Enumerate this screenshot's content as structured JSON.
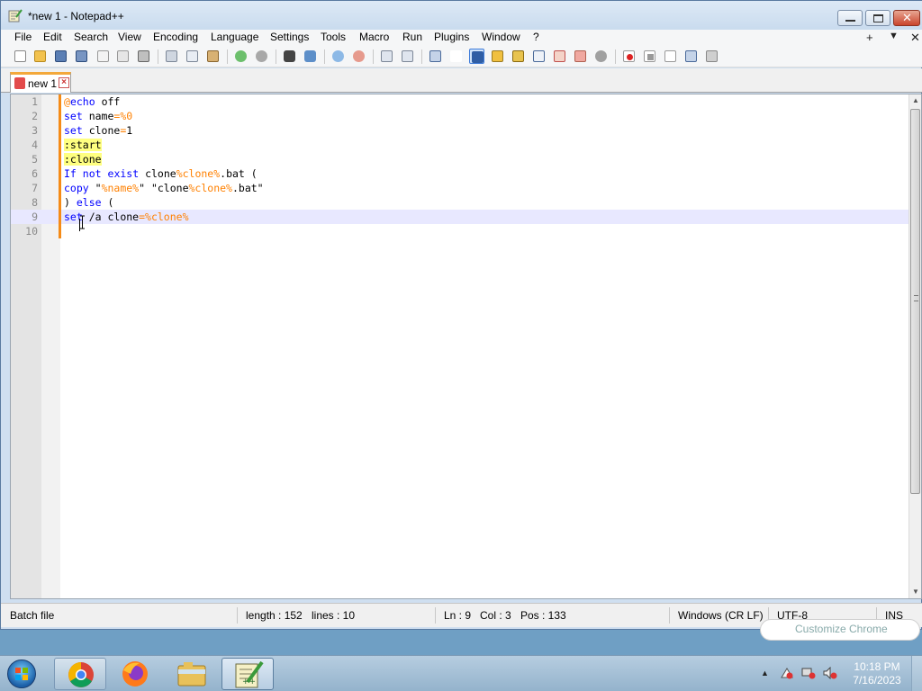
{
  "window": {
    "title": "*new 1 - Notepad++",
    "minimize_glyph": "",
    "close_glyph": "✕"
  },
  "menu": {
    "items": [
      "File",
      "Edit",
      "Search",
      "View",
      "Encoding",
      "Language",
      "Settings",
      "Tools",
      "Macro",
      "Run",
      "Plugins",
      "Window",
      "?"
    ],
    "right_plus": "+",
    "right_down": "▼",
    "right_close": "✕"
  },
  "toolbar": {
    "icons": [
      "new-file-icon",
      "open-file-icon",
      "save-icon",
      "save-all-icon",
      "close-icon",
      "close-all-icon",
      "print-icon",
      "cut-icon",
      "copy-icon",
      "paste-icon",
      "undo-icon",
      "redo-icon",
      "find-icon",
      "replace-icon",
      "zoom-in-icon",
      "zoom-out-icon",
      "sync-vertical-icon",
      "sync-horizontal-icon",
      "word-wrap-icon",
      "show-all-chars-icon",
      "indent-guide-icon",
      "user-language-icon",
      "document-map-icon",
      "function-list-icon",
      "folder-workspace-icon",
      "monitoring-icon",
      "record-macro-icon",
      "stop-record-icon",
      "play-macro-icon",
      "run-macro-multiple-icon",
      "save-macro-icon"
    ]
  },
  "tab": {
    "label": "new 1",
    "close_glyph": "×"
  },
  "editor": {
    "line_numbers": [
      "1",
      "2",
      "3",
      "4",
      "5",
      "6",
      "7",
      "8",
      "9",
      "10"
    ],
    "current_line": 9,
    "lines": [
      [
        {
          "t": "@",
          "c": "op"
        },
        {
          "t": "echo",
          "c": "kw"
        },
        {
          "t": " off",
          "c": "str"
        }
      ],
      [
        {
          "t": "set",
          "c": "kw"
        },
        {
          "t": " name",
          "c": "str"
        },
        {
          "t": "=",
          "c": "op"
        },
        {
          "t": "%0",
          "c": "var"
        }
      ],
      [
        {
          "t": "set",
          "c": "kw"
        },
        {
          "t": " clone",
          "c": "str"
        },
        {
          "t": "=",
          "c": "op"
        },
        {
          "t": "1",
          "c": "str"
        }
      ],
      [
        {
          "t": ":start",
          "c": "hl"
        }
      ],
      [
        {
          "t": ":clone",
          "c": "hl"
        }
      ],
      [
        {
          "t": "If",
          "c": "kw"
        },
        {
          "t": " ",
          "c": "str"
        },
        {
          "t": "not",
          "c": "kw"
        },
        {
          "t": " ",
          "c": "str"
        },
        {
          "t": "exist",
          "c": "kw"
        },
        {
          "t": " clone",
          "c": "str"
        },
        {
          "t": "%clone%",
          "c": "var"
        },
        {
          "t": ".bat (",
          "c": "str"
        }
      ],
      [
        {
          "t": "copy",
          "c": "kw"
        },
        {
          "t": " \"",
          "c": "str"
        },
        {
          "t": "%name%",
          "c": "var"
        },
        {
          "t": "\" \"clone",
          "c": "str"
        },
        {
          "t": "%clone%",
          "c": "var"
        },
        {
          "t": ".bat\"",
          "c": "str"
        }
      ],
      [
        {
          "t": ") ",
          "c": "str"
        },
        {
          "t": "else",
          "c": "kw"
        },
        {
          "t": " (",
          "c": "str"
        }
      ],
      [
        {
          "t": "set",
          "c": "kw"
        },
        {
          "t": " /a clone",
          "c": "str"
        },
        {
          "t": "=",
          "c": "op"
        },
        {
          "t": "%clone%",
          "c": "var"
        }
      ],
      []
    ]
  },
  "status": {
    "file_type": "Batch file",
    "length": "length : 152",
    "lines": "lines : 10",
    "ln": "Ln : 9",
    "col": "Col : 3",
    "pos": "Pos : 133",
    "eol": "Windows (CR LF)",
    "encoding": "UTF-8",
    "mode": "INS"
  },
  "background_popup": {
    "text": "Customize Chrome"
  },
  "taskbar": {
    "apps": [
      "chrome-icon",
      "firefox-icon",
      "file-explorer-icon",
      "notepadpp-icon"
    ],
    "clock_time": "10:18 PM",
    "clock_date": "7/16/2023",
    "tray_arrow": "▲"
  }
}
